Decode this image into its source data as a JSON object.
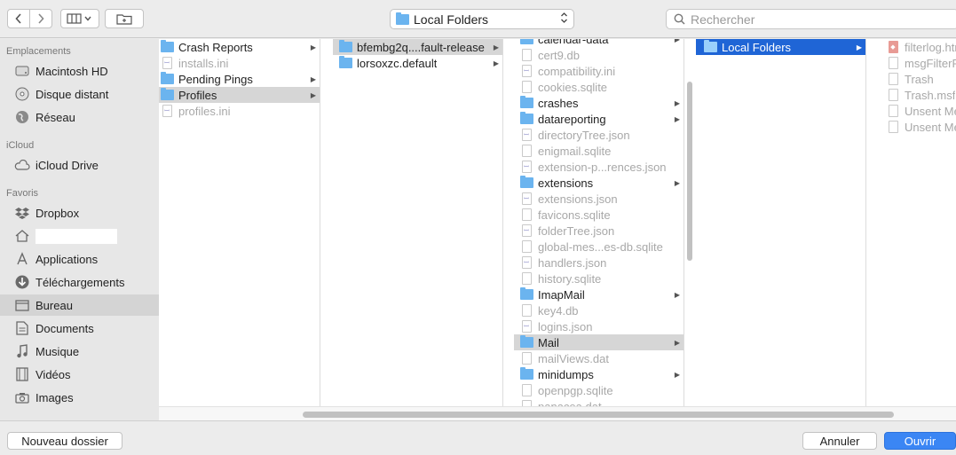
{
  "toolbar": {
    "location": "Local Folders",
    "search_placeholder": "Rechercher"
  },
  "sidebar": {
    "sections": [
      {
        "header": "Emplacements",
        "items": [
          "Macintosh HD",
          "Disque distant",
          "Réseau"
        ]
      },
      {
        "header": "iCloud",
        "items": [
          "iCloud Drive"
        ]
      },
      {
        "header": "Favoris",
        "items": [
          "Dropbox",
          "",
          "Applications",
          "Téléchargements",
          "Bureau",
          "Documents",
          "Musique",
          "Vidéos",
          "Images"
        ]
      }
    ],
    "selected": "Bureau"
  },
  "columns": [
    {
      "items": [
        {
          "name": "Crash Reports",
          "type": "folder"
        },
        {
          "name": "installs.ini",
          "type": "file"
        },
        {
          "name": "Pending Pings",
          "type": "folder"
        },
        {
          "name": "Profiles",
          "type": "folder"
        },
        {
          "name": "profiles.ini",
          "type": "file"
        }
      ]
    },
    {
      "items": [
        {
          "name": "bfembg2q....fault-release",
          "type": "folder"
        },
        {
          "name": "lorsoxzc.default",
          "type": "folder"
        }
      ]
    },
    {
      "items": [
        {
          "name": "calendar-data",
          "type": "folder"
        },
        {
          "name": "cert9.db",
          "type": "file"
        },
        {
          "name": "compatibility.ini",
          "type": "file"
        },
        {
          "name": "cookies.sqlite",
          "type": "file"
        },
        {
          "name": "crashes",
          "type": "folder"
        },
        {
          "name": "datareporting",
          "type": "folder"
        },
        {
          "name": "directoryTree.json",
          "type": "file"
        },
        {
          "name": "enigmail.sqlite",
          "type": "file"
        },
        {
          "name": "extension-p...rences.json",
          "type": "file"
        },
        {
          "name": "extensions",
          "type": "folder"
        },
        {
          "name": "extensions.json",
          "type": "file"
        },
        {
          "name": "favicons.sqlite",
          "type": "file"
        },
        {
          "name": "folderTree.json",
          "type": "file"
        },
        {
          "name": "global-mes...es-db.sqlite",
          "type": "file"
        },
        {
          "name": "handlers.json",
          "type": "file"
        },
        {
          "name": "history.sqlite",
          "type": "file"
        },
        {
          "name": "ImapMail",
          "type": "folder"
        },
        {
          "name": "key4.db",
          "type": "file"
        },
        {
          "name": "logins.json",
          "type": "file"
        },
        {
          "name": "Mail",
          "type": "folder"
        },
        {
          "name": "mailViews.dat",
          "type": "file"
        },
        {
          "name": "minidumps",
          "type": "folder"
        },
        {
          "name": "openpgp.sqlite",
          "type": "file"
        },
        {
          "name": "panacea.dat",
          "type": "file"
        }
      ]
    },
    {
      "items": [
        {
          "name": "Local Folders",
          "type": "folder"
        }
      ]
    },
    {
      "items": [
        {
          "name": "filterlog.html",
          "type": "file"
        },
        {
          "name": "msgFilterRules.dat",
          "type": "file"
        },
        {
          "name": "Trash",
          "type": "file"
        },
        {
          "name": "Trash.msf",
          "type": "file"
        },
        {
          "name": "Unsent Messages",
          "type": "file"
        },
        {
          "name": "Unsent Messages.msf",
          "type": "file"
        }
      ]
    }
  ],
  "buttons": {
    "new_folder": "Nouveau dossier",
    "cancel": "Annuler",
    "open": "Ouvrir"
  },
  "colors": {
    "accent": "#3b86f4",
    "selection": "#1f65d6",
    "folder": "#6bb4ef"
  }
}
